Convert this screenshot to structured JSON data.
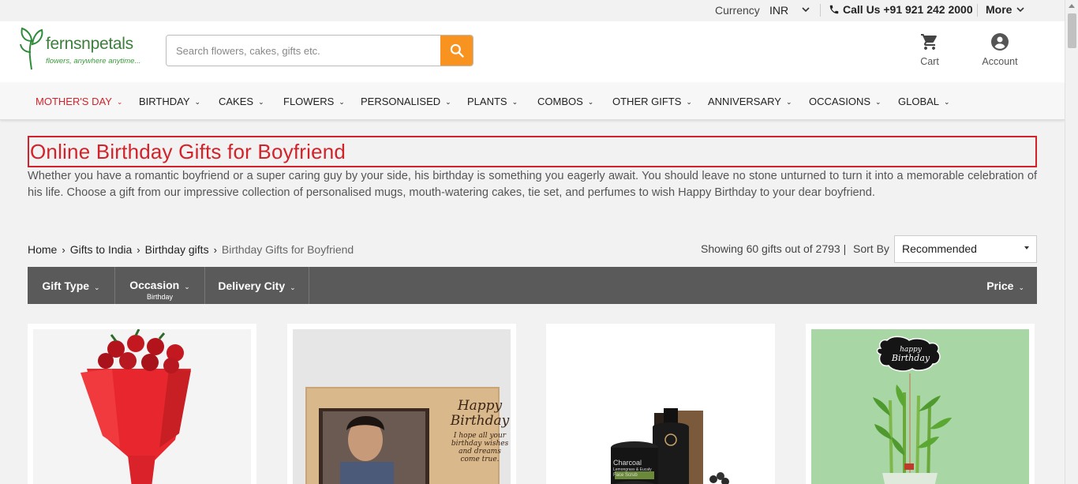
{
  "topbar": {
    "currency_label": "Currency",
    "currency_value": "INR",
    "call_label": "Call Us +91 921 242 2000",
    "more_label": "More"
  },
  "header": {
    "brand": "fernsnpetals",
    "tagline": "flowers, anywhere anytime...",
    "search_placeholder": "Search flowers, cakes, gifts etc.",
    "cart_label": "Cart",
    "account_label": "Account"
  },
  "nav": {
    "items": [
      {
        "label": "MOTHER'S DAY"
      },
      {
        "label": "BIRTHDAY"
      },
      {
        "label": "CAKES"
      },
      {
        "label": "FLOWERS"
      },
      {
        "label": "PERSONALISED"
      },
      {
        "label": "PLANTS"
      },
      {
        "label": "COMBOS"
      },
      {
        "label": "OTHER GIFTS"
      },
      {
        "label": "ANNIVERSARY"
      },
      {
        "label": "OCCASIONS"
      },
      {
        "label": "GLOBAL"
      }
    ]
  },
  "page": {
    "title": "Online Birthday Gifts for Boyfriend",
    "intro": "Whether you have a romantic boyfriend or a super caring guy by your side, his birthday is something you eagerly await. You should leave no stone unturned to turn it into a memorable celebration of his life. Choose a gift from our impressive collection of personalised mugs, mouth-watering cakes, tie set, and perfumes to wish Happy Birthday to your dear boyfriend."
  },
  "breadcrumb": {
    "items": [
      "Home",
      "Gifts to India",
      "Birthday gifts",
      "Birthday Gifts for Boyfriend"
    ]
  },
  "listing": {
    "showing": "Showing 60 gifts out of 2793 |",
    "sort_label": "Sort By",
    "sort_value": "Recommended"
  },
  "filters": {
    "gift_type": "Gift Type",
    "occasion": "Occasion",
    "occasion_sub": "Birthday",
    "delivery_city": "Delivery City",
    "price": "Price"
  },
  "products": {
    "frame_text_title": "Happy Birthday",
    "frame_text_body": "I hope all your birthday wishes and dreams come true.",
    "scrub_label": "Charcoal",
    "scrub_label_2": "Lemongrass & Eucaly",
    "scrub_label_3": "Face Scrub",
    "tag_text_1": "happy",
    "tag_text_2": "Birthday"
  },
  "colors": {
    "accent_red": "#d2232a",
    "brand_green": "#3b7f3b",
    "search_orange": "#f7931e",
    "filter_bar": "#5a5a5a"
  }
}
